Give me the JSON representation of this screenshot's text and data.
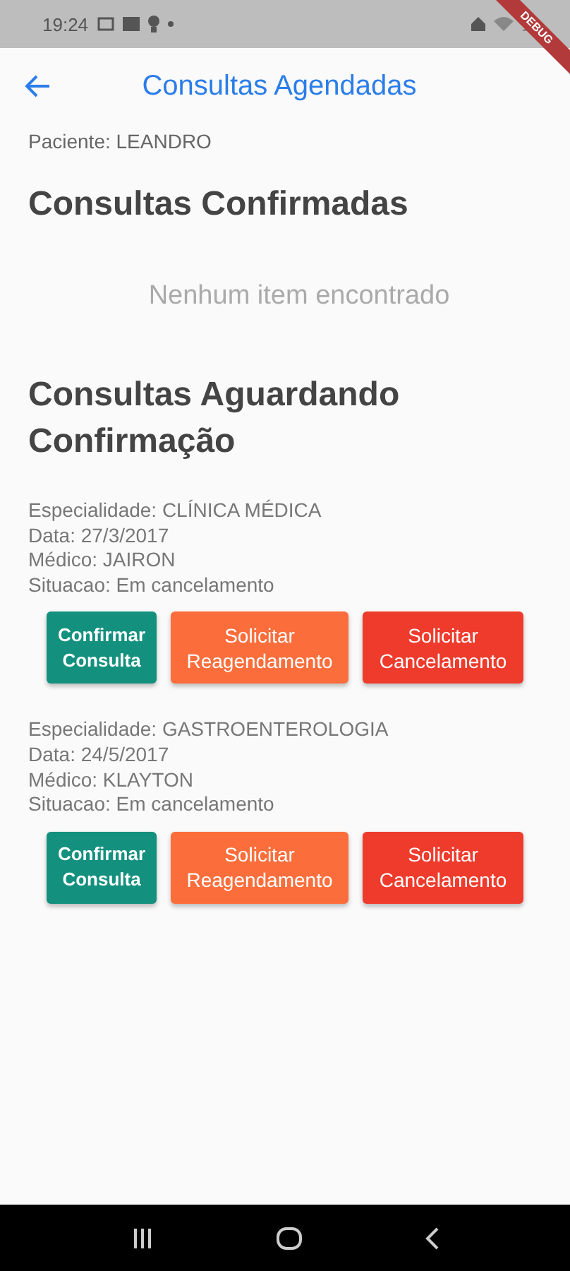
{
  "status_bar": {
    "time": "19:24"
  },
  "debug_banner": {
    "label": "DEBUG"
  },
  "app_bar": {
    "title": "Consultas Agendadas"
  },
  "patient": "Paciente: LEANDRO",
  "confirmed": {
    "heading": "Consultas Confirmadas",
    "empty_message": "Nenhum item encontrado"
  },
  "pending": {
    "heading": "Consultas Aguardando Confirmação",
    "appointments": [
      {
        "lines": [
          "Especialidade: CLÍNICA MÉDICA",
          "Data: 27/3/2017",
          "Médico: JAIRON",
          "Situacao: Em cancelamento"
        ],
        "buttons": [
          {
            "kind": "confirm",
            "label": "Confirmar Consulta"
          },
          {
            "kind": "reschedule",
            "label": "Solicitar Reagendamento"
          },
          {
            "kind": "cancel",
            "label": "Solicitar Cancelamento"
          }
        ]
      },
      {
        "lines": [
          "Especialidade: GASTROENTEROLOGIA",
          "Data: 24/5/2017",
          "Médico: KLAYTON",
          "Situacao: Em cancelamento"
        ],
        "buttons": [
          {
            "kind": "confirm",
            "label": "Confirmar Consulta"
          },
          {
            "kind": "reschedule",
            "label": "Solicitar Reagendamento"
          },
          {
            "kind": "cancel",
            "label": "Solicitar Cancelamento"
          }
        ]
      }
    ]
  }
}
